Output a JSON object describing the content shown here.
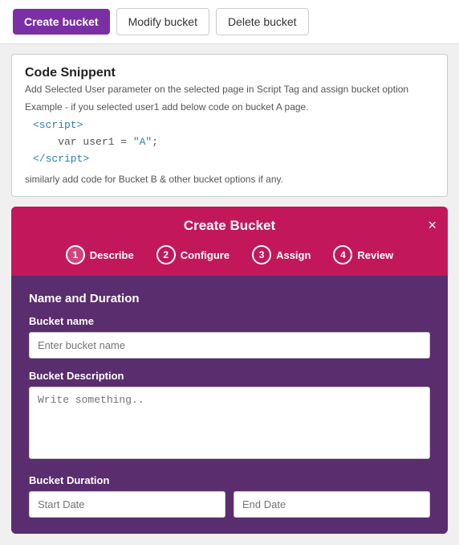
{
  "toolbar": {
    "create_label": "Create bucket",
    "modify_label": "Modify bucket",
    "delete_label": "Delete bucket"
  },
  "code_snippet": {
    "title": "Code Snippent",
    "subtitle": "Add Selected User parameter on the selected page in Script Tag and assign bucket option",
    "example_label": "Example - if you selected user1 add below code on bucket A page.",
    "code_lines": [
      "<script>",
      "    var user1 = \"A\";",
      "</script>"
    ],
    "note": "similarly add code for Bucket B & other bucket options if any."
  },
  "modal": {
    "title": "Create Bucket",
    "close_icon": "×",
    "steps": [
      {
        "number": "1",
        "label": "Describe"
      },
      {
        "number": "2",
        "label": "Configure"
      },
      {
        "number": "3",
        "label": "Assign"
      },
      {
        "number": "4",
        "label": "Review"
      }
    ],
    "section_title": "Name and Duration",
    "bucket_name_label": "Bucket name",
    "bucket_name_placeholder": "Enter bucket name",
    "bucket_desc_label": "Bucket Description",
    "bucket_desc_placeholder": "Write something..",
    "bucket_duration_label": "Bucket Duration",
    "start_date_placeholder": "Start Date",
    "end_date_placeholder": "End Date"
  }
}
